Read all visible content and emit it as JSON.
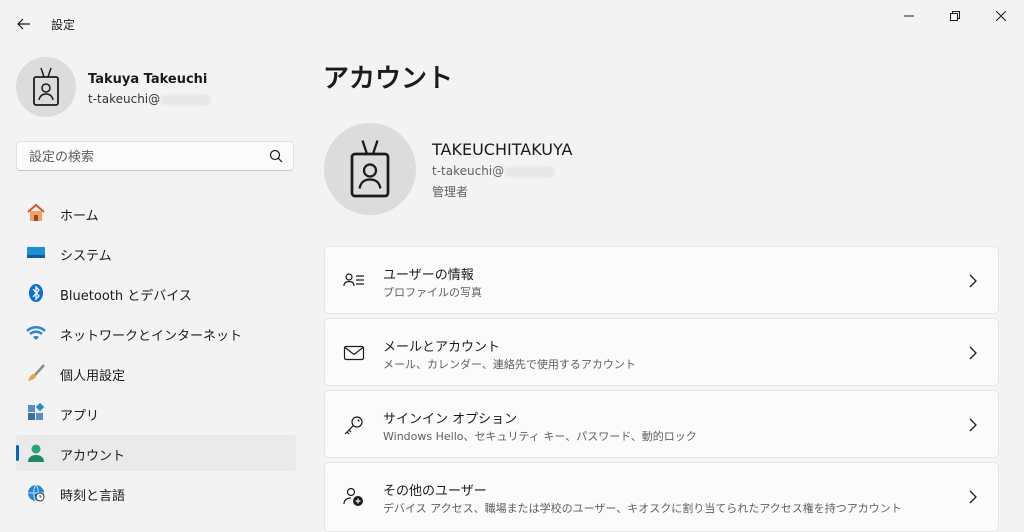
{
  "window": {
    "title": "設定",
    "controls": [
      "minimize",
      "restore",
      "close"
    ]
  },
  "profile": {
    "name": "Takuya Takeuchi",
    "email": "t-takeuchi@"
  },
  "search": {
    "placeholder": "設定の検索"
  },
  "nav": {
    "items": [
      {
        "label": "ホーム",
        "icon": "home-icon"
      },
      {
        "label": "システム",
        "icon": "system-icon"
      },
      {
        "label": "Bluetooth とデバイス",
        "icon": "bluetooth-icon"
      },
      {
        "label": "ネットワークとインターネット",
        "icon": "wifi-icon"
      },
      {
        "label": "個人用設定",
        "icon": "brush-icon"
      },
      {
        "label": "アプリ",
        "icon": "apps-icon"
      },
      {
        "label": "アカウント",
        "icon": "account-icon",
        "selected": true
      },
      {
        "label": "時刻と言語",
        "icon": "time-language-icon"
      }
    ]
  },
  "main": {
    "title": "アカウント",
    "account": {
      "name": "TAKEUCHITAKUYA",
      "email": "t-takeuchi@",
      "role": "管理者"
    },
    "cards": [
      {
        "title": "ユーザーの情報",
        "subtitle": "プロファイルの写真",
        "icon": "user-info-icon"
      },
      {
        "title": "メールとアカウント",
        "subtitle": "メール、カレンダー、連絡先で使用するアカウント",
        "icon": "mail-icon"
      },
      {
        "title": "サインイン オプション",
        "subtitle": "Windows Hello、セキュリティ キー、パスワード、動的ロック",
        "icon": "key-icon"
      },
      {
        "title": "その他のユーザー",
        "subtitle": "デバイス アクセス、職場または学校のユーザー、キオスクに割り当てられたアクセス権を持つアカウント",
        "icon": "add-user-icon"
      }
    ]
  },
  "colors": {
    "accent": "#0067c0",
    "background": "#f3f3f3",
    "card": "#fbfbfb"
  }
}
